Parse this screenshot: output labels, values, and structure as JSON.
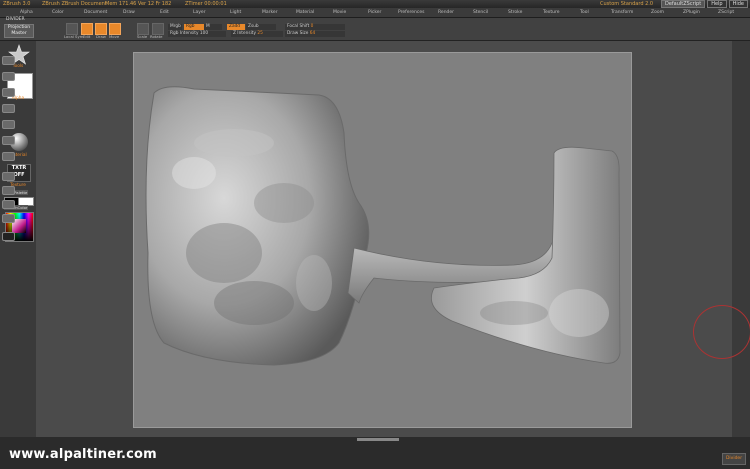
{
  "titlebar": {
    "app": "ZBrush 3.0",
    "document": "ZBrush ZBrush Document",
    "mem": "Mem 171.46  Ver 12  Fr 182",
    "timer": "ZTimer 00:00:01",
    "custom": "Custom Standard 2.0",
    "script": "DefaultZScript",
    "help": "Help",
    "hide": "Hide"
  },
  "menubar": {
    "items": [
      "Alpha",
      "Color",
      "Document",
      "Draw",
      "Edit",
      "Layer",
      "Light",
      "Marker",
      "Material",
      "Movie",
      "Picker",
      "Preferences",
      "Render",
      "Stencil",
      "Stroke",
      "Texture",
      "Tool",
      "Transform",
      "Zoom",
      "ZPlugin",
      "ZScript"
    ]
  },
  "shelf": {
    "divider": "DIVIDER",
    "projection_master": "Projection Master",
    "tools": [
      {
        "label": "Local Sym",
        "on": false
      },
      {
        "label": "Edit",
        "on": true
      },
      {
        "label": "Draw",
        "on": true
      },
      {
        "label": "Move",
        "on": true
      },
      {
        "label": "Scale",
        "on": false
      },
      {
        "label": "Rotate",
        "on": false
      }
    ],
    "mrgb": "Mrgb",
    "rgb": "Rgb",
    "m": "M",
    "zadd": "Zadd",
    "zsub": "Zsub",
    "focal_shift_label": "Focal Shift",
    "focal_shift_value": "0",
    "rgb_intensity_label": "Rgb Intensity",
    "rgb_intensity_value": "100",
    "z_intensity_label": "Z Intensity",
    "z_intensity_value": "25",
    "draw_size_label": "Draw Size",
    "draw_size_value": "64"
  },
  "leftpanel": {
    "current_tool": "Tools",
    "alpha": "Alpha",
    "material": "Material",
    "texture_btn": "TXTR OFF",
    "texture": "Texture",
    "sync_palette": "SyncPalette",
    "switch_color": "SwitchColor"
  },
  "canvas": {
    "background": "#808080"
  },
  "footer": {
    "watermark": "www.alpaltiner.com",
    "divider": "Divider"
  },
  "colors": {
    "accent": "#e8882a",
    "background": "#2b2b2b"
  }
}
